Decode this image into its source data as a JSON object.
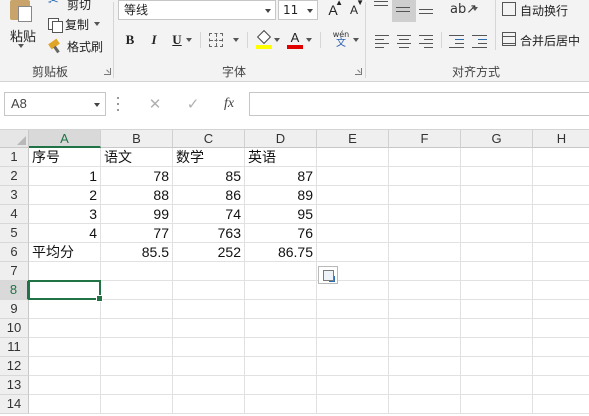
{
  "ribbon": {
    "clipboard": {
      "paste_label": "粘贴",
      "cut_label": "剪切",
      "copy_label": "复制",
      "format_painter_label": "格式刷",
      "group_label": "剪贴板"
    },
    "font": {
      "font_name": "等线",
      "font_size": "11",
      "grow_label": "A",
      "shrink_label": "A",
      "bold_label": "B",
      "italic_label": "I",
      "underline_label": "U",
      "font_color_label": "A",
      "phonetic_top": "wén",
      "phonetic_bottom": "文",
      "group_label": "字体",
      "fill_color": "#ffff00",
      "font_color": "#e00000"
    },
    "alignment": {
      "wrap_label": "自动换行",
      "merge_label": "合并后居中",
      "group_label": "对齐方式"
    }
  },
  "formula_bar": {
    "name_box": "A8",
    "cancel_icon": "✕",
    "enter_icon": "✓",
    "fx_label": "fx",
    "formula": ""
  },
  "grid": {
    "columns": [
      "A",
      "B",
      "C",
      "D",
      "E",
      "F",
      "G",
      "H"
    ],
    "rows": [
      "1",
      "2",
      "3",
      "4",
      "5",
      "6",
      "7",
      "8",
      "9",
      "10",
      "11",
      "12",
      "13",
      "14"
    ],
    "selected_column": "A",
    "selected_row": "8",
    "selected_cell": "A8",
    "cells": [
      [
        "序号",
        "语文",
        "数学",
        "英语"
      ],
      [
        "1",
        "78",
        "85",
        "87"
      ],
      [
        "2",
        "88",
        "86",
        "89"
      ],
      [
        "3",
        "99",
        "74",
        "95"
      ],
      [
        "4",
        "77",
        "763",
        "76"
      ],
      [
        "平均分",
        "85.5",
        "252",
        "86.75"
      ]
    ]
  },
  "theme": {
    "accent": "#217346"
  }
}
